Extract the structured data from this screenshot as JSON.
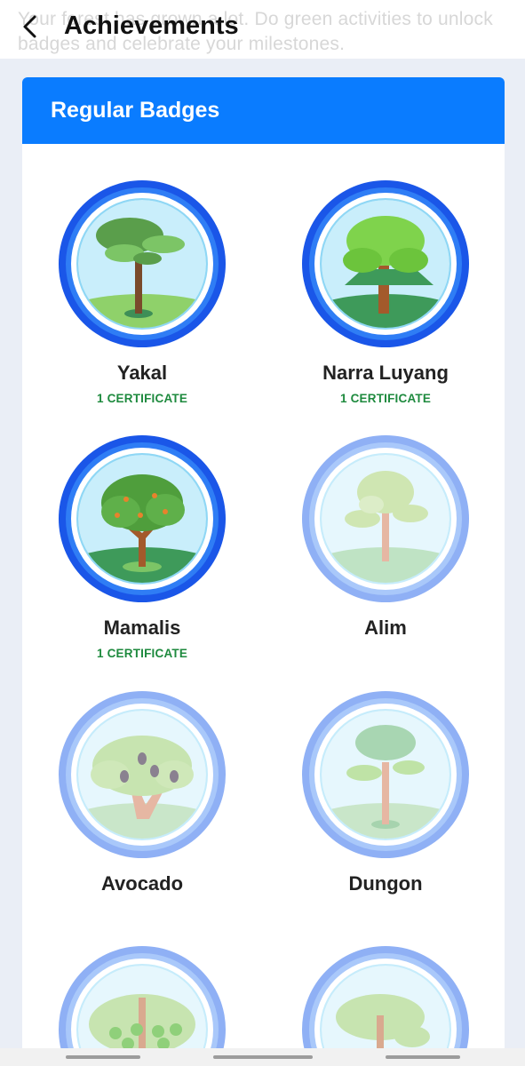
{
  "header": {
    "title": "Achievements",
    "subtitle": "Your forest has grown a lot. Do green activities to unlock badges and celebrate your milestones."
  },
  "section": {
    "title": "Regular Badges"
  },
  "badges": [
    {
      "name": "Yakal",
      "certificate": "1 CERTIFICATE",
      "unlocked": true
    },
    {
      "name": "Narra Luyang",
      "certificate": "1 CERTIFICATE",
      "unlocked": true
    },
    {
      "name": "Mamalis",
      "certificate": "1 CERTIFICATE",
      "unlocked": true
    },
    {
      "name": "Alim",
      "certificate": "",
      "unlocked": false
    },
    {
      "name": "Avocado",
      "certificate": "",
      "unlocked": false
    },
    {
      "name": "Dungon",
      "certificate": "",
      "unlocked": false
    },
    {
      "name": "",
      "certificate": "",
      "unlocked": false
    },
    {
      "name": "",
      "certificate": "",
      "unlocked": false
    }
  ],
  "colors": {
    "accent": "#0a7cff",
    "certificate": "#1e8a3e",
    "badge_ring_unlocked": "#1a56e8",
    "badge_ring_locked": "#8fb0f5"
  },
  "icons": {
    "back": "chevron-left-icon"
  }
}
